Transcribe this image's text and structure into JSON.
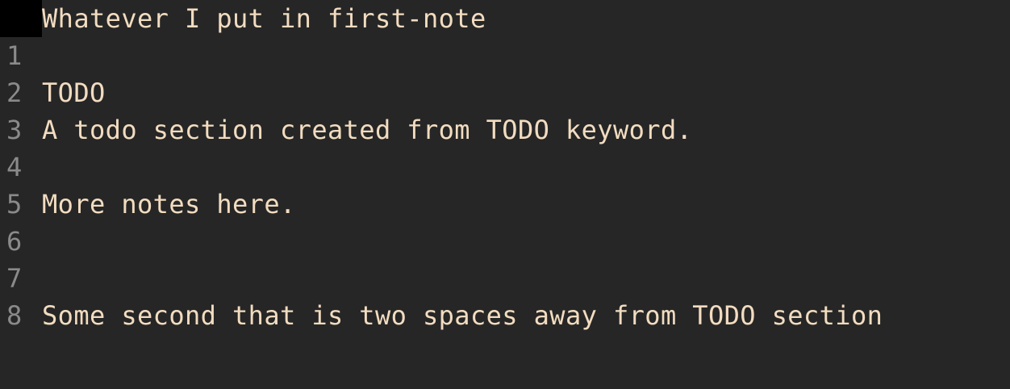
{
  "colors": {
    "background": "#262626",
    "text": "#f2dcc0",
    "line_number": "#8a8a8a",
    "cursor_block": "#000000"
  },
  "editor": {
    "header_line": "Whatever I put in first-note",
    "lines": [
      {
        "number": "1",
        "text": ""
      },
      {
        "number": "2",
        "text": "TODO"
      },
      {
        "number": "3",
        "text": "A todo section created from TODO keyword."
      },
      {
        "number": "4",
        "text": ""
      },
      {
        "number": "5",
        "text": "More notes here."
      },
      {
        "number": "6",
        "text": ""
      },
      {
        "number": "7",
        "text": ""
      },
      {
        "number": "8",
        "text": "Some second that is two spaces away from TODO section"
      }
    ]
  }
}
